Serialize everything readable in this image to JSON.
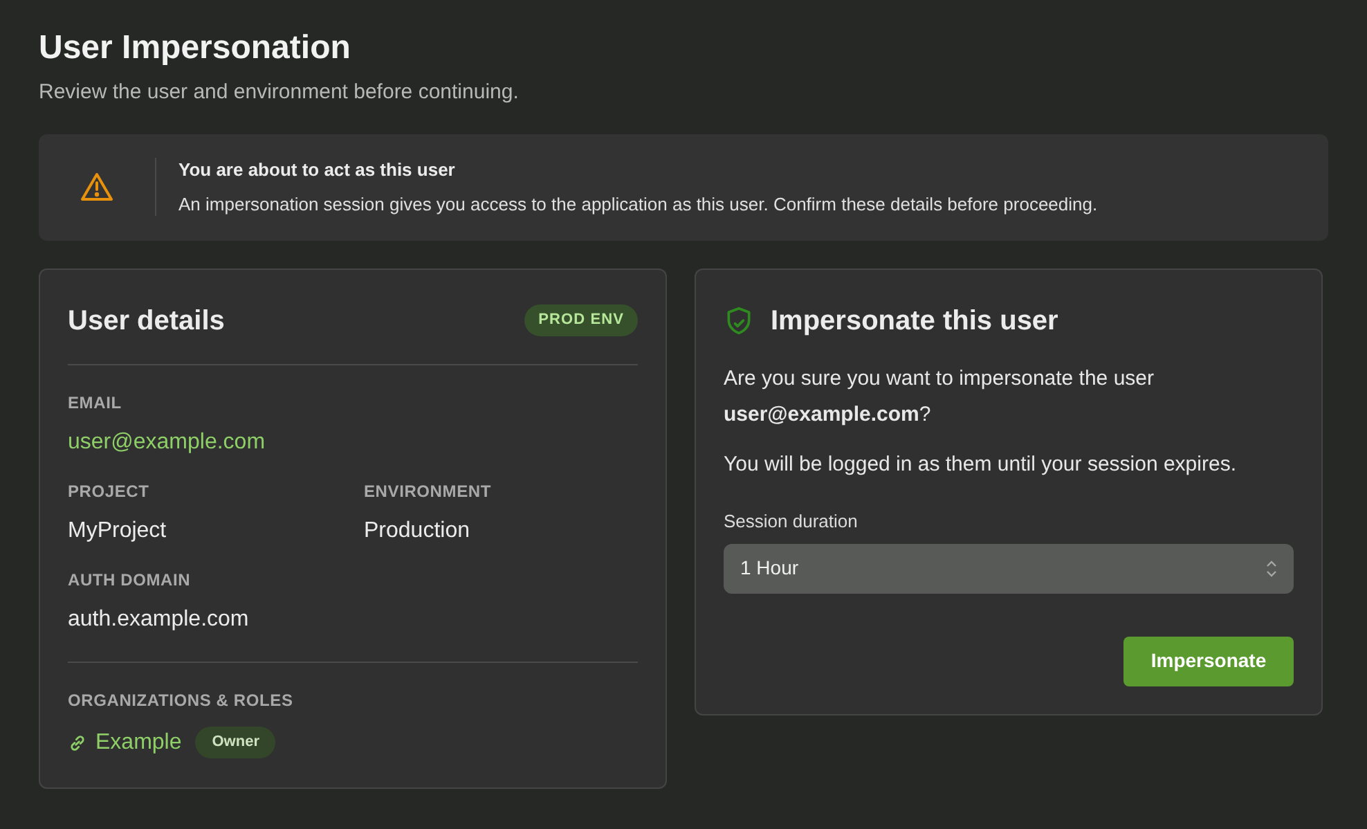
{
  "header": {
    "title": "User Impersonation",
    "subtitle": "Review the user and environment before continuing."
  },
  "alert": {
    "title": "You are about to act as this user",
    "message": "An impersonation session gives you access to the application as this user. Confirm these details before proceeding."
  },
  "user_details": {
    "title": "User details",
    "badge": "PROD ENV",
    "fields": [
      {
        "label": "EMAIL",
        "value": "user@example.com",
        "kind": "link"
      },
      {
        "label": "PROJECT",
        "value": "MyProject",
        "kind": "text"
      },
      {
        "label": "ENVIRONMENT",
        "value": "Production",
        "kind": "text"
      },
      {
        "label": "AUTH DOMAIN",
        "value": "auth.example.com",
        "kind": "text"
      }
    ],
    "organizations": {
      "label": "ORGANIZATIONS & ROLES",
      "items": [
        {
          "name": "Example",
          "role": "Owner"
        }
      ]
    }
  },
  "impersonate": {
    "title": "Impersonate this user",
    "question": "Are you sure you want to impersonate the user **user@example.com**?",
    "note": "You will be logged in as them until your session expires.",
    "duration_label": "Session duration",
    "duration_value": "1 Hour",
    "button": "Impersonate"
  }
}
